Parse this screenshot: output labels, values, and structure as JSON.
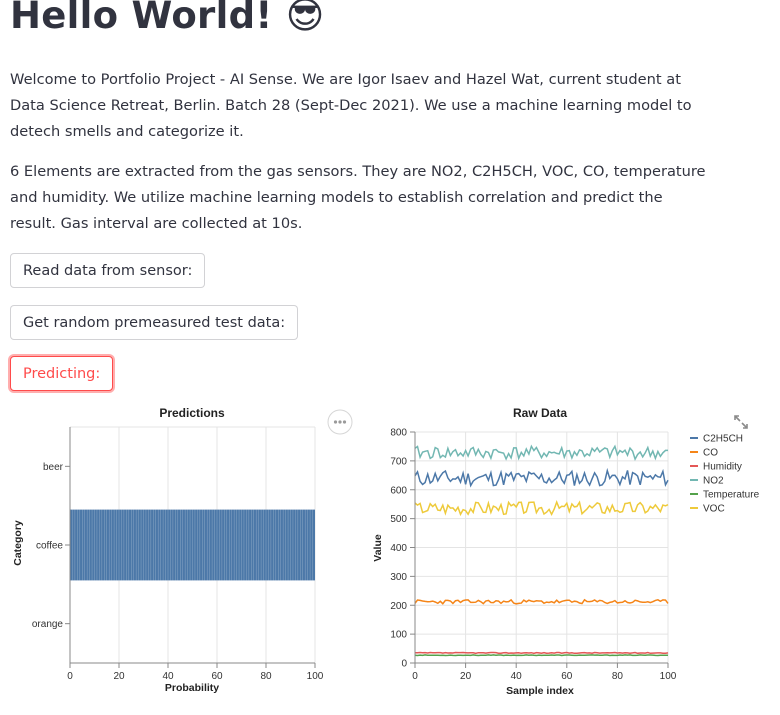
{
  "page": {
    "title": "Hello World! 😎",
    "paragraph1": "Welcome to Portfolio Project - AI Sense. We are Igor Isaev and Hazel Wat, current student at Data Science Retreat, Berlin. Batch 28 (Sept-Dec 2021). We use a machine learning model to detech smells and categorize it.",
    "paragraph2": "6 Elements are extracted from the gas sensors. They are NO2, C2H5CH, VOC, CO, temperature and humidity. We utilize machine learning models to establish correlation and predict the result. Gas interval are collected at 10s."
  },
  "buttons": {
    "read_sensor": "Read data from sensor:",
    "random_test": "Get random premeasured test data:",
    "predicting": "Predicting:"
  },
  "icons": {
    "more": "more-horizontal-icon",
    "expand": "fullscreen-expand-icon"
  },
  "colors": {
    "accent": "#ff4b4b",
    "bar": "#4c78a8"
  },
  "chart_data": [
    {
      "type": "bar",
      "orientation": "horizontal",
      "title": "Predictions",
      "xlabel": "Probability",
      "ylabel": "Category",
      "categories": [
        "beer",
        "coffee",
        "orange"
      ],
      "values": [
        0,
        100,
        0
      ],
      "xlim": [
        0,
        100
      ],
      "xticks": [
        0,
        20,
        40,
        60,
        80,
        100
      ],
      "grid": true
    },
    {
      "type": "line",
      "title": "Raw Data",
      "xlabel": "Sample index",
      "ylabel": "Value",
      "xlim": [
        0,
        100
      ],
      "ylim": [
        0,
        800
      ],
      "xticks": [
        0,
        20,
        40,
        60,
        80,
        100
      ],
      "yticks": [
        0,
        100,
        200,
        300,
        400,
        500,
        600,
        700,
        800
      ],
      "grid": true,
      "legend_position": "right",
      "series": [
        {
          "name": "C2H5CH",
          "color": "#4c78a8",
          "mean": 640,
          "amplitude": 55,
          "seed": 11
        },
        {
          "name": "CO",
          "color": "#f58518",
          "mean": 212,
          "amplitude": 14,
          "seed": 23
        },
        {
          "name": "Humidity",
          "color": "#e45756",
          "mean": 35,
          "amplitude": 3,
          "seed": 37
        },
        {
          "name": "NO2",
          "color": "#72b7b2",
          "mean": 728,
          "amplitude": 45,
          "seed": 41
        },
        {
          "name": "Temperature",
          "color": "#54a24b",
          "mean": 27,
          "amplitude": 2,
          "seed": 53
        },
        {
          "name": "VOC",
          "color": "#eeca3b",
          "mean": 537,
          "amplitude": 45,
          "seed": 67
        }
      ]
    }
  ]
}
